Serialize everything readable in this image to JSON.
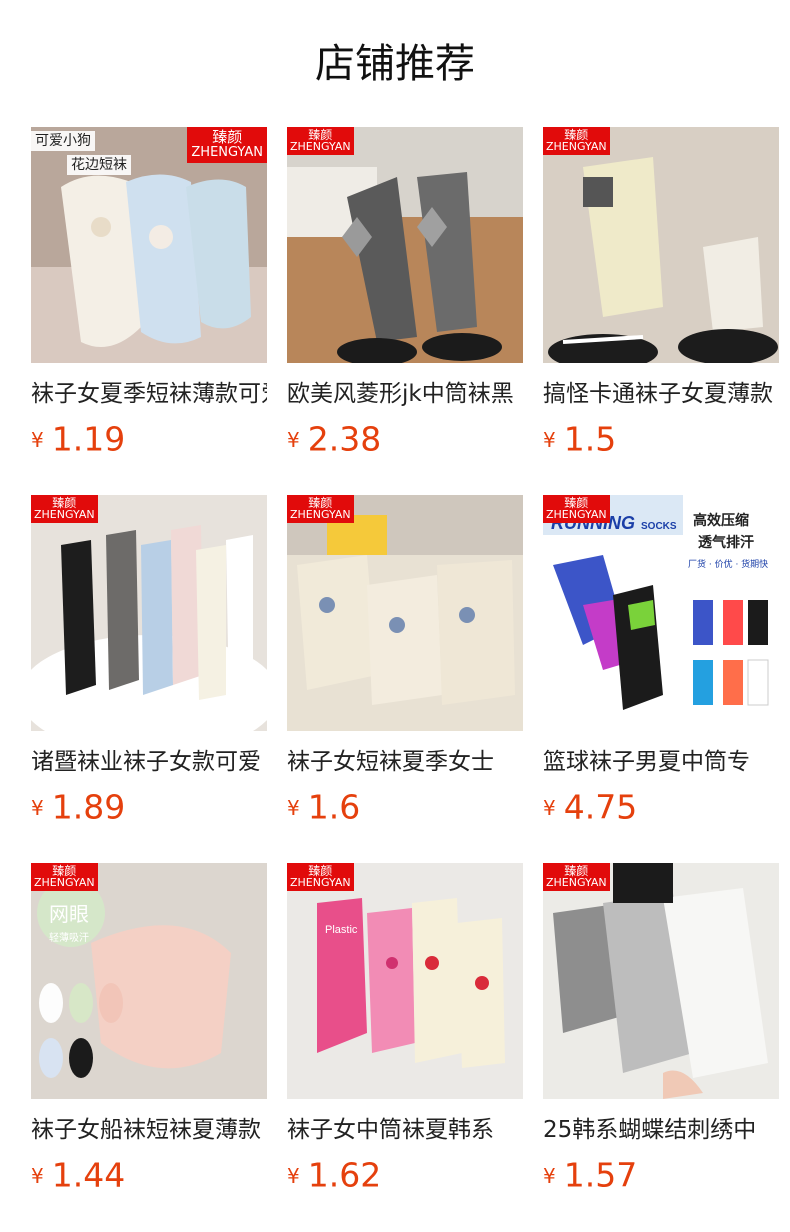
{
  "header": {
    "title": "店铺推荐"
  },
  "currency_symbol": "¥",
  "brand_tag": {
    "line1": "臻颜",
    "line2": "ZHENGYAN"
  },
  "products": [
    {
      "title": "袜子女夏季短袜薄款可爱",
      "price": "1.19",
      "overlay": [
        "可爱小狗",
        "花边短袜"
      ]
    },
    {
      "title": "欧美风菱形jk中筒袜黑",
      "price": "2.38"
    },
    {
      "title": "搞怪卡通袜子女夏薄款",
      "price": "1.5"
    },
    {
      "title": "诸暨袜业袜子女款可爱",
      "price": "1.89"
    },
    {
      "title": "袜子女短袜夏季女士",
      "price": "1.6"
    },
    {
      "title": "篮球袜子男夏中筒专",
      "price": "4.75"
    },
    {
      "title": "袜子女船袜短袜夏薄款",
      "price": "1.44"
    },
    {
      "title": "袜子女中筒袜夏韩系",
      "price": "1.62"
    },
    {
      "title": "25韩系蝴蝶结刺绣中",
      "price": "1.57"
    }
  ],
  "image_text": {
    "running": "RUNNING",
    "socks": "SOCKS",
    "compress": "高效压缩",
    "breath": "透气排汗",
    "features": "厂货 · 价优 · 货期快",
    "mesh": "网眼",
    "mesh_sub": "轻薄吸汗",
    "plastic": "Plastic"
  },
  "colors": {
    "accent": "#e5400d",
    "brand_tag": "#e10b0b"
  }
}
